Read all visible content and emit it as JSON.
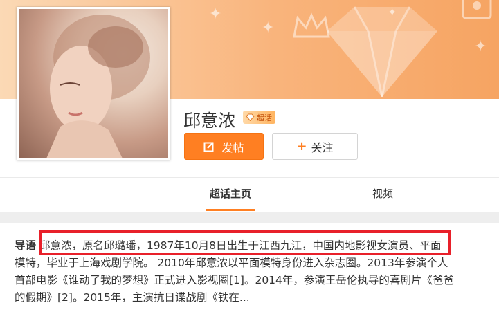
{
  "profile": {
    "name": "邱意浓",
    "badge_label": "超话",
    "post_button": "发帖",
    "follow_button": "关注",
    "follow_plus": "+"
  },
  "tabs": [
    {
      "label": "超话主页",
      "active": true
    },
    {
      "label": "视频",
      "active": false
    }
  ],
  "intro": {
    "label": "导语",
    "line1": " 邱意浓，原名邱璐璠，1987年10月8日出生于江西九江，中国内地影视女演员、平面",
    "line2": "模特，毕业于上海戏剧学院。 2010年邱意浓以平面模特身份进入杂志圈。2013年参演个人",
    "line3": "首部电影《谁动了我的梦想》正式进入影视圈[1]。2014年，参演王岳伦执导的喜剧片《爸爸",
    "line4": "的假期》[2]。2015年，主演抗日谍战剧《铁在..."
  },
  "colors": {
    "accent": "#ff7f22",
    "highlight": "#e8202a",
    "banner_start": "#fbd9b5",
    "banner_end": "#f6a462"
  },
  "icons": {
    "post": "edit-icon",
    "badge": "diamond-icon",
    "follow": "plus-icon"
  }
}
